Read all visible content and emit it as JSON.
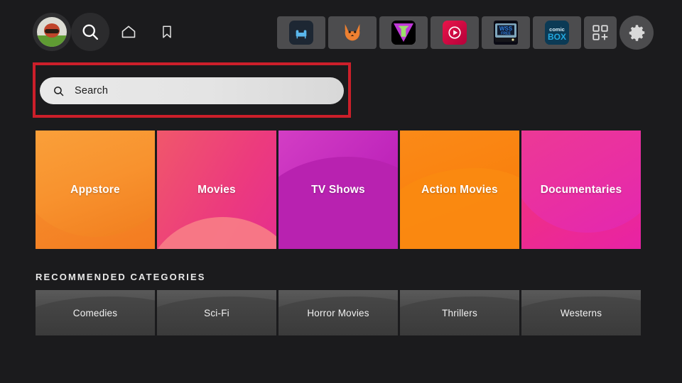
{
  "topbar": {
    "avatar_name": "profile-avatar",
    "nav": [
      {
        "id": "search",
        "icon": "search-icon",
        "label": "Search",
        "active": true
      },
      {
        "id": "home",
        "icon": "home-icon",
        "label": "Home",
        "active": false
      },
      {
        "id": "bookmarks",
        "icon": "bookmark-icon",
        "label": "Bookmarks",
        "active": false
      }
    ],
    "apps": [
      {
        "id": "couch",
        "icon": "couch-app-icon",
        "label": "Cinema"
      },
      {
        "id": "fox",
        "icon": "fox-app-icon",
        "label": "Fox"
      },
      {
        "id": "tea",
        "icon": "tea-app-icon",
        "label": "TeaTV"
      },
      {
        "id": "redplay",
        "icon": "red-play-app-icon",
        "label": "Red Play"
      },
      {
        "id": "wss",
        "icon": "wss-free-app-icon",
        "label": "WSS FREE"
      },
      {
        "id": "comicbox",
        "icon": "comic-box-app-icon",
        "label": "comic BOX"
      }
    ],
    "apps_grid_label": "Apps",
    "settings_label": "Settings"
  },
  "search": {
    "placeholder": "Search",
    "value": "",
    "icon": "search-icon",
    "highlight_color": "#cc1f2a",
    "highlighted": true
  },
  "tiles": [
    {
      "label": "Appstore",
      "color": "#f58a2a"
    },
    {
      "label": "Movies",
      "color": "#ec3a7e"
    },
    {
      "label": "TV Shows",
      "color": "#c229bd"
    },
    {
      "label": "Action Movies",
      "color": "#f9820f"
    },
    {
      "label": "Documentaries",
      "color": "#ef2f86"
    }
  ],
  "recommended": {
    "title": "RECOMMENDED CATEGORIES",
    "items": [
      {
        "label": "Comedies"
      },
      {
        "label": "Sci-Fi"
      },
      {
        "label": "Horror Movies"
      },
      {
        "label": "Thrillers"
      },
      {
        "label": "Westerns"
      }
    ]
  },
  "theme": {
    "background": "#1b1b1d",
    "tile_gray": "#4c4c4e",
    "text": "#ffffff"
  }
}
